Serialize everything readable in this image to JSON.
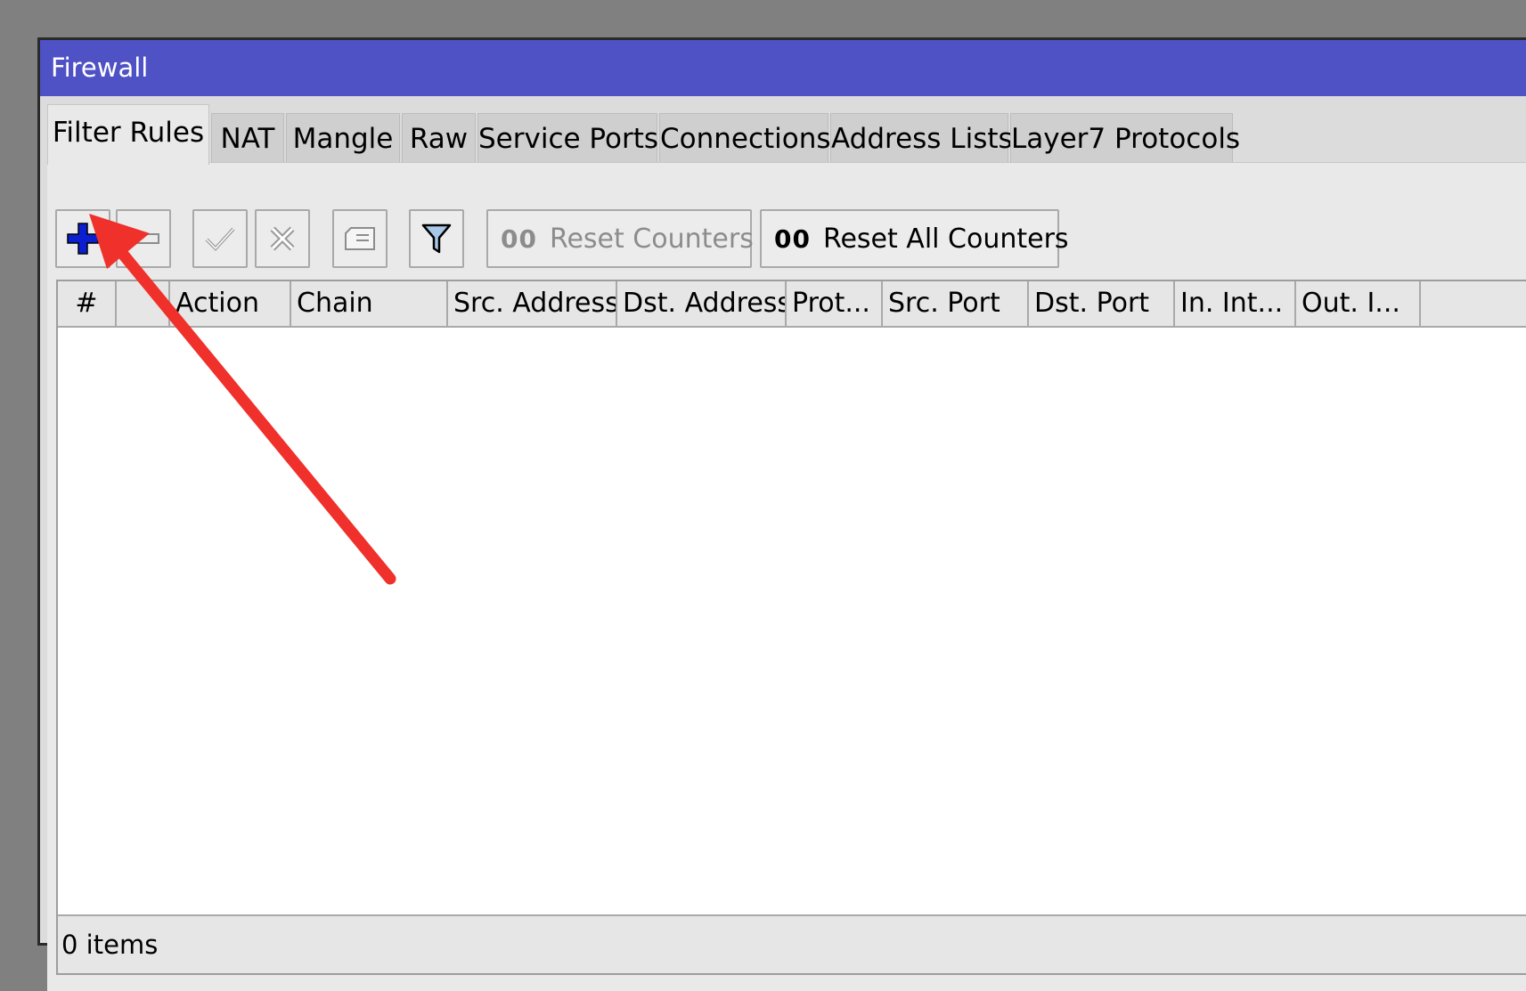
{
  "window": {
    "title": "Firewall"
  },
  "tabs": [
    {
      "label": "Filter Rules",
      "active": true
    },
    {
      "label": "NAT"
    },
    {
      "label": "Mangle"
    },
    {
      "label": "Raw"
    },
    {
      "label": "Service Ports"
    },
    {
      "label": "Connections"
    },
    {
      "label": "Address Lists"
    },
    {
      "label": "Layer7 Protocols"
    }
  ],
  "toolbar": {
    "add_icon": "plus-icon",
    "remove_icon": "minus-icon",
    "enable_icon": "check-icon",
    "disable_icon": "cross-icon",
    "comment_icon": "note-icon",
    "filter_icon": "funnel-icon",
    "counter_glyph": "00",
    "reset_counters_label": "Reset Counters",
    "reset_all_counters_label": "Reset All Counters"
  },
  "table": {
    "columns": [
      "#",
      "",
      "Action",
      "Chain",
      "Src. Address",
      "Dst. Address",
      "Prot...",
      "Src. Port",
      "Dst. Port",
      "In. Int...",
      "Out. I..."
    ],
    "rows": []
  },
  "status": {
    "items_text": "0 items"
  },
  "colors": {
    "titlebar": "#4f52c4",
    "add_icon": "#0b1fd0",
    "annotation_arrow": "#f0302a"
  }
}
